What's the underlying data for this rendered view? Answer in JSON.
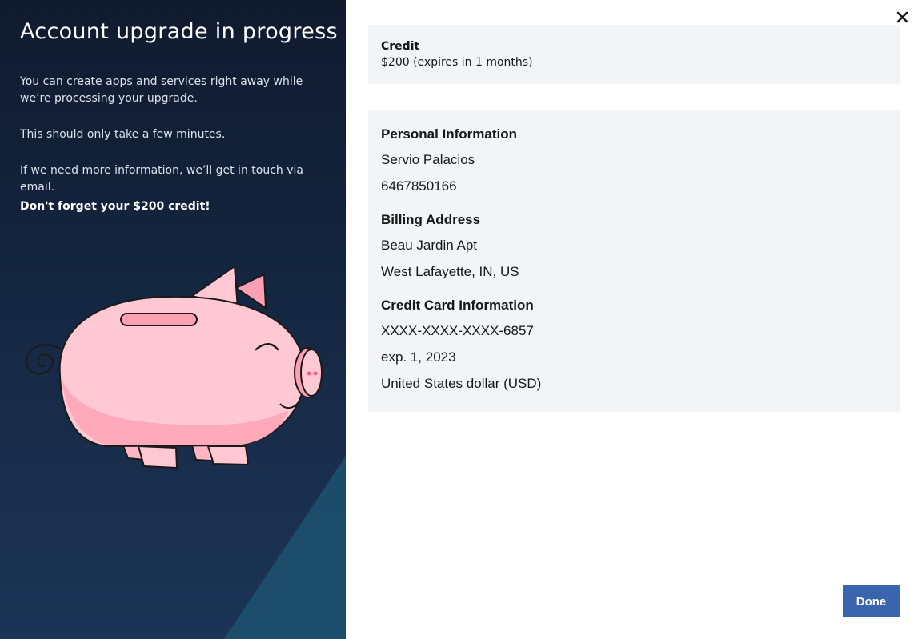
{
  "left_panel": {
    "title": "Account upgrade in progress",
    "paragraphs": [
      "You can create apps and services right away while we’re processing your upgrade.",
      "This should only take a few minutes.",
      "If we need more information, we’ll get in touch via email."
    ],
    "reminder": "Don't forget your $200 credit!",
    "illustration": "piggy-bank"
  },
  "credit": {
    "label": "Credit",
    "value": "$200 (expires in 1 months)"
  },
  "personal_information": {
    "heading": "Personal Information",
    "name": "Servio Palacios",
    "phone": "6467850166"
  },
  "billing_address": {
    "heading": "Billing Address",
    "line1": "Beau Jardin Apt",
    "line2": "West Lafayette, IN, US"
  },
  "credit_card": {
    "heading": "Credit Card Information",
    "number": "XXXX-XXXX-XXXX-6857",
    "expiry": "exp. 1, 2023",
    "currency": "United States dollar (USD)"
  },
  "actions": {
    "done_label": "Done",
    "close_icon": "close-icon"
  },
  "colors": {
    "left_bg": "#13213a",
    "accent_triangle": "#1c4f6e",
    "panel_bg": "#f2f4f8",
    "primary_button": "#3a64ad",
    "pig_pink": "#ffc8d3"
  }
}
